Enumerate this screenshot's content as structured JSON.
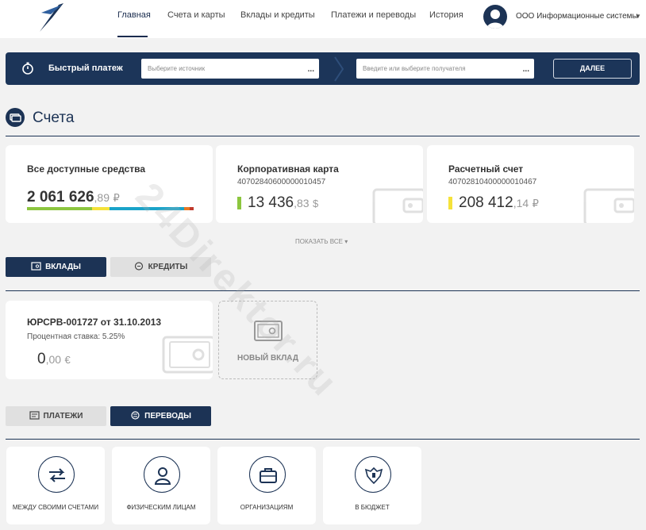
{
  "nav": {
    "items": [
      {
        "label": "Главная"
      },
      {
        "label": "Счета и карты"
      },
      {
        "label": "Вклады и кредиты"
      },
      {
        "label": "Платежи и переводы"
      },
      {
        "label": "История"
      }
    ],
    "active_index": 0,
    "org_name": "ООО Информационные системы"
  },
  "quick_payment": {
    "title": "Быстрый платеж",
    "source_placeholder": "Выберите источник",
    "recipient_placeholder": "Введите или выберите получателя",
    "submit_label": "ДАЛЕЕ",
    "dots": "..."
  },
  "accounts": {
    "section_title": "Счета",
    "cards": [
      {
        "title": "Все доступные средства",
        "account": "",
        "amount_main": "2 061 626",
        "amount_dec": ",89",
        "currency": "₽"
      },
      {
        "title": "Корпоративная карта",
        "account": "40702840600000010457",
        "amount_main": "13 436",
        "amount_dec": ",83",
        "currency": "$",
        "indicator_color": "#8cc63f"
      },
      {
        "title": "Расчетный счет",
        "account": "40702810400000010467",
        "amount_main": "208 412",
        "amount_dec": ",14",
        "currency": "₽",
        "indicator_color": "#f5e23a"
      }
    ],
    "distribution_colors": [
      "#8cc63f",
      "#f5e23a",
      "#1aa3c9",
      "#e87722",
      "#c0392b"
    ],
    "show_all": "ПОКАЗАТЬ ВСЕ ▾"
  },
  "deposit_tabs": {
    "deposits": "ВКЛАДЫ",
    "credits": "КРЕДИТЫ"
  },
  "deposit": {
    "title": "ЮРСРВ-001727 от 31.10.2013",
    "rate": "Процентная ставка: 5.25%",
    "amount_main": "0",
    "amount_dec": ",00",
    "currency": "€",
    "new_label": "НОВЫЙ ВКЛАД"
  },
  "payment_tabs": {
    "payments": "ПЛАТЕЖИ",
    "transfers": "ПЕРЕВОДЫ"
  },
  "transfers": [
    {
      "label": "МЕЖДУ СВОИМИ СЧЕТАМИ",
      "icon": "exchange-arrows-icon"
    },
    {
      "label": "ФИЗИЧЕСКИМ ЛИЦАМ",
      "icon": "person-icon"
    },
    {
      "label": "ОРГАНИЗАЦИЯМ",
      "icon": "briefcase-icon"
    },
    {
      "label": "В БЮДЖЕТ",
      "icon": "coat-of-arms-icon"
    }
  ],
  "colors": {
    "brand": "#1c3355",
    "background": "#f2f2f2"
  },
  "watermark": "24Direktor.ru"
}
